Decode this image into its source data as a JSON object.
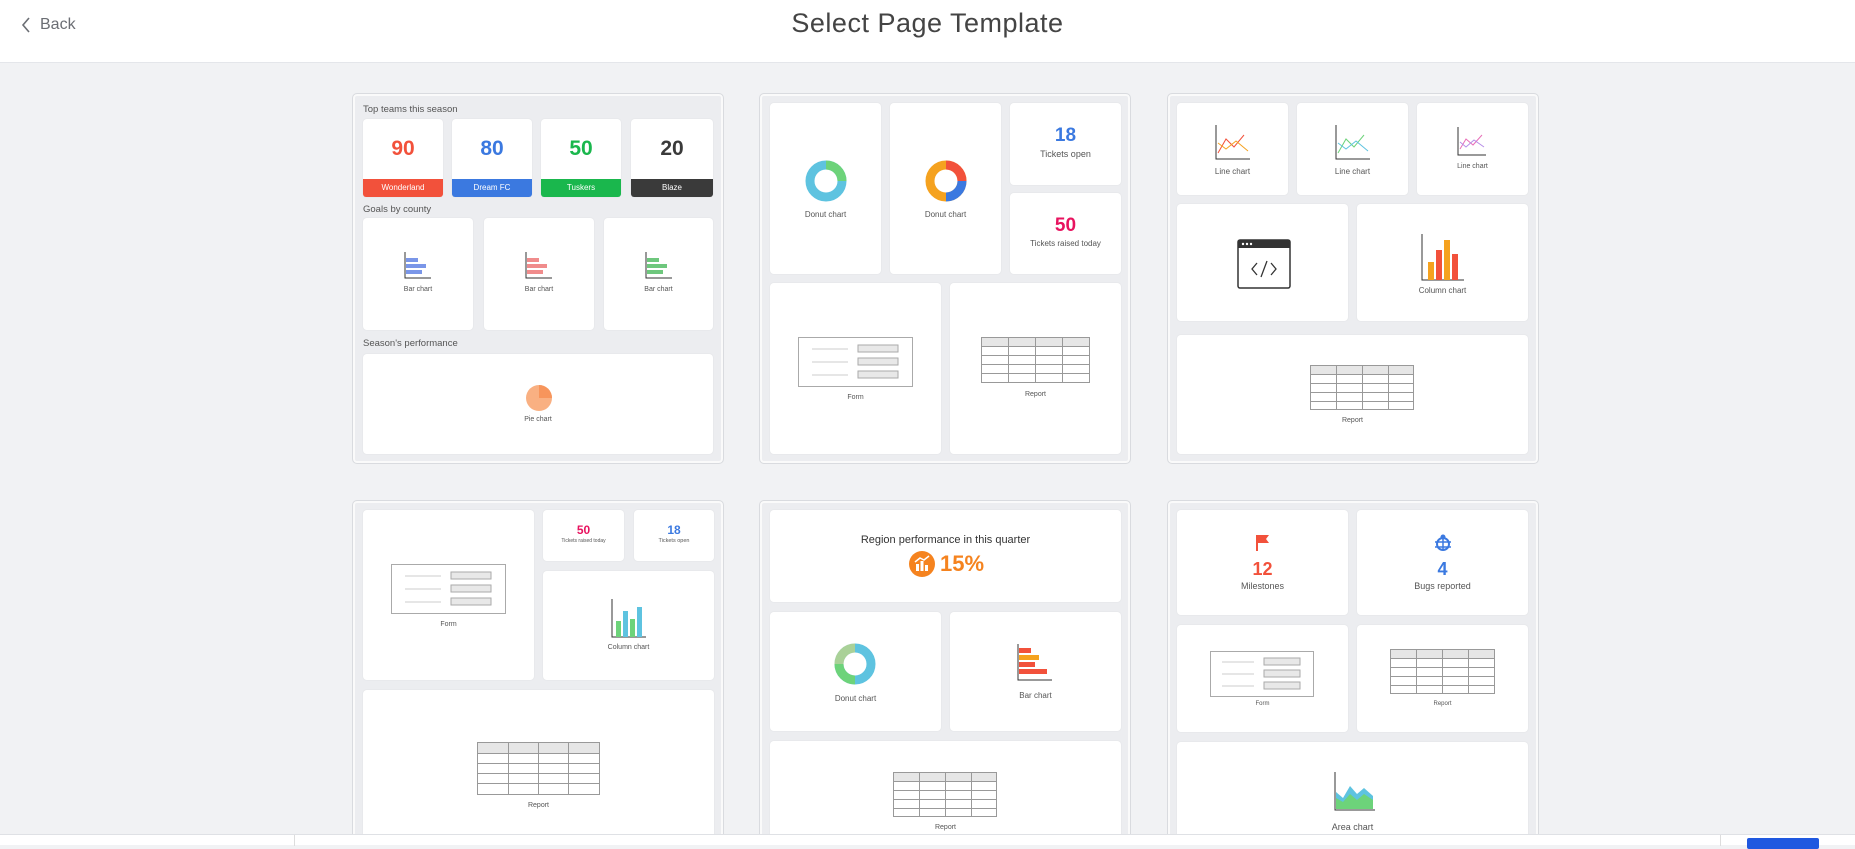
{
  "header": {
    "back_label": "Back",
    "title": "Select Page Template"
  },
  "colors": {
    "red": "#f2513b",
    "blue": "#3b79e0",
    "green": "#1ab74d",
    "dark": "#3a3a3a",
    "pink": "#e8135f",
    "orange": "#f5831f",
    "primary_button": "#1f58e0"
  },
  "templates": {
    "t1": {
      "section_top": "Top teams this season",
      "teams": [
        {
          "value": "90",
          "name": "Wonderland"
        },
        {
          "value": "80",
          "name": "Dream FC"
        },
        {
          "value": "50",
          "name": "Tuskers"
        },
        {
          "value": "20",
          "name": "Blaze"
        }
      ],
      "section_goals": "Goals by county",
      "bar_label": "Bar chart",
      "section_perf": "Season's performance",
      "pie_label": "Pie chart"
    },
    "t2": {
      "donut_label": "Donut chart",
      "tickets_open_value": "18",
      "tickets_open_label": "Tickets open",
      "tickets_today_value": "50",
      "tickets_today_label": "Tickets raised today",
      "form_label": "Form",
      "report_label": "Report"
    },
    "t3": {
      "line_label": "Line chart",
      "column_label": "Column chart",
      "report_label": "Report"
    },
    "t4": {
      "form_label": "Form",
      "tickets_today_value": "50",
      "tickets_today_label": "Tickets raised today",
      "tickets_open_value": "18",
      "tickets_open_label": "Tickets open",
      "column_label": "Column chart",
      "report_label": "Report"
    },
    "t5": {
      "region_title": "Region performance in this quarter",
      "region_value": "15%",
      "donut_label": "Donut chart",
      "bar_label": "Bar chart",
      "report_label": "Report"
    },
    "t6": {
      "milestones_value": "12",
      "milestones_label": "Milestones",
      "bugs_value": "4",
      "bugs_label": "Bugs reported",
      "form_label": "Form",
      "report_label": "Report",
      "area_label": "Area chart"
    }
  }
}
